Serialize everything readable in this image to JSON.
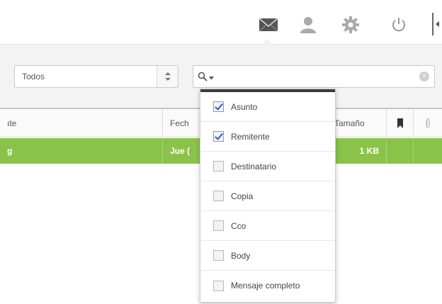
{
  "filter": {
    "selected": "Todos"
  },
  "search": {
    "value": "",
    "placeholder": ""
  },
  "table": {
    "columns": {
      "sender": "ıte",
      "date": "Fech",
      "size": "Tamaño"
    },
    "rows": [
      {
        "sender": "g",
        "date": "Jue (",
        "size": "1 KB"
      }
    ]
  },
  "search_scope_menu": {
    "items": [
      {
        "label": "Asunto",
        "checked": true
      },
      {
        "label": "Remitente",
        "checked": true
      },
      {
        "label": "Destinatario",
        "checked": false
      },
      {
        "label": "Copia",
        "checked": false
      },
      {
        "label": "Cco",
        "checked": false
      },
      {
        "label": "Body",
        "checked": false
      },
      {
        "label": "Mensaje completo",
        "checked": false
      }
    ]
  },
  "icons": {
    "mail": "envelope-icon",
    "contacts": "user-icon",
    "settings": "gear-icon",
    "logout": "power-icon",
    "flag": "bookmark-icon",
    "attachment": "paperclip-icon",
    "search": "search-icon",
    "clear": "clear-icon",
    "select_arrows": "up-down-arrows-icon"
  },
  "colors": {
    "selected_row": "#8bc34a",
    "checkbox_checked": "#3b55b0"
  }
}
